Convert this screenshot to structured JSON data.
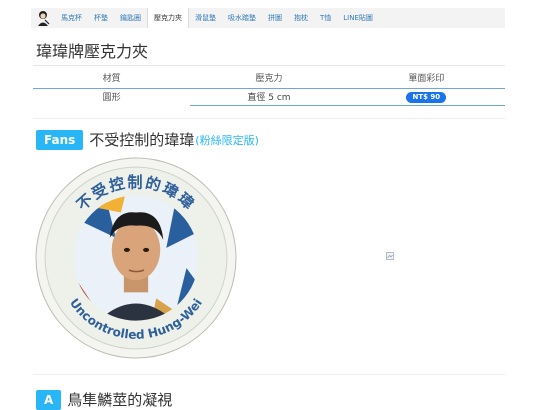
{
  "nav": {
    "items": [
      {
        "label": "馬克杯",
        "active": false
      },
      {
        "label": "杯墊",
        "active": false
      },
      {
        "label": "鑰匙圈",
        "active": false
      },
      {
        "label": "壓克力夾",
        "active": true
      },
      {
        "label": "滑鼠墊",
        "active": false
      },
      {
        "label": "吸水踏墊",
        "active": false
      },
      {
        "label": "拼圖",
        "active": false
      },
      {
        "label": "抱枕",
        "active": false
      },
      {
        "label": "T恤",
        "active": false
      },
      {
        "label": "LINE貼圖",
        "active": false
      }
    ]
  },
  "product": {
    "title": "瑋瑋牌壓克力夾"
  },
  "specs": {
    "headers": [
      "材質",
      "壓克力",
      "單面彩印"
    ],
    "row": [
      "圓形",
      "直徑 5 cm",
      "NT$ 90"
    ]
  },
  "section_fans": {
    "badge": "Fans",
    "title": "不受控制的瑋瑋",
    "subtitle": "(粉絲限定版)",
    "ring_text_top": "不受控制的瑋瑋",
    "ring_text_bottom": "Uncontrolled Hung-Wei"
  },
  "section_a": {
    "badge": "A",
    "title": "鳥隼鱗莖的凝視"
  },
  "colors": {
    "accent": "#29b6f6",
    "price_pill": "#1a73e8",
    "link": "#337ab7"
  }
}
